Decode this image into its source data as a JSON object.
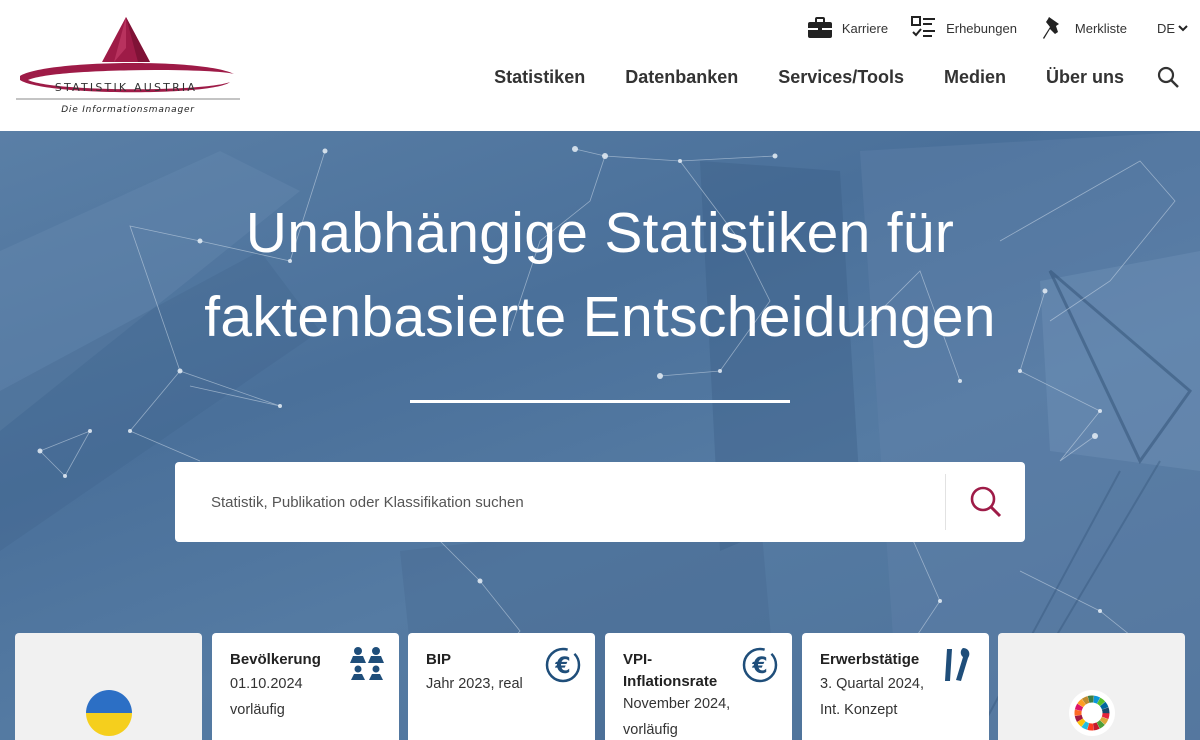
{
  "header": {
    "logo": {
      "wordmark": "STATISTIK AUSTRIA",
      "tagline": "Die Informationsmanager"
    },
    "utility": [
      {
        "label": "Karriere",
        "icon": "briefcase-icon"
      },
      {
        "label": "Erhebungen",
        "icon": "checklist-icon"
      },
      {
        "label": "Merkliste",
        "icon": "pushpin-icon"
      }
    ],
    "language": "DE",
    "nav": [
      "Statistiken",
      "Datenbanken",
      "Services/Tools",
      "Medien",
      "Über uns"
    ]
  },
  "hero": {
    "title_line1": "Unabhängige Statistiken für",
    "title_line2": "faktenbasierte Entscheidungen",
    "search": {
      "placeholder": "Statistik, Publikation oder Klassifikation suchen"
    }
  },
  "cards": [
    {
      "title": "",
      "icon": "ukraine-flag-icon",
      "lines": []
    },
    {
      "title": "Bevölkerung",
      "icon": "people-icon",
      "lines": [
        "01.10.2024",
        "vorläufig"
      ]
    },
    {
      "title": "BIP",
      "icon": "euro-icon",
      "lines": [
        "Jahr 2023, real"
      ]
    },
    {
      "title": "VPI-\nInflationsrate",
      "title_lines": [
        "VPI-",
        "Inflationsrate"
      ],
      "icon": "euro-icon",
      "lines": [
        "November 2024,",
        "vorläufig"
      ]
    },
    {
      "title": "Erwerbstätige",
      "icon": "tools-icon",
      "lines": [
        "3. Quartal 2024,",
        "Int. Konzept"
      ]
    },
    {
      "title": "",
      "icon": "sdg-wheel-icon",
      "lines": []
    }
  ],
  "colors": {
    "brand": "#9e1b47",
    "hero_blue": "#50769e",
    "card_icon": "#1f4e7a"
  }
}
